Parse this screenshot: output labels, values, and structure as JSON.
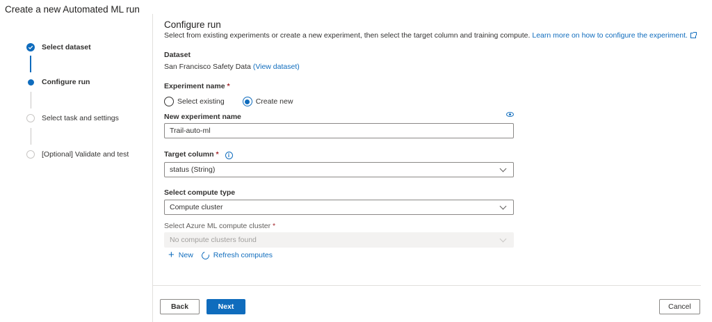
{
  "page": {
    "title": "Create a new Automated ML run"
  },
  "steps": [
    {
      "label": "Select dataset",
      "state": "done"
    },
    {
      "label": "Configure run",
      "state": "current"
    },
    {
      "label": "Select task and settings",
      "state": "pending"
    },
    {
      "label": "[Optional] Validate and test",
      "state": "pending"
    }
  ],
  "configure": {
    "title": "Configure run",
    "description": "Select from existing experiments or create a new experiment, then select the target column and training compute.",
    "learn_more": "Learn more on how to configure the experiment."
  },
  "dataset": {
    "label": "Dataset",
    "name": "San Francisco Safety Data",
    "view_link": "(View dataset)"
  },
  "experiment": {
    "label": "Experiment name",
    "required_mark": "*",
    "option_existing": "Select existing",
    "option_new": "Create new",
    "selected": "Create new",
    "new_name_label": "New experiment name",
    "new_name_value": "Trail-auto-ml"
  },
  "target_column": {
    "label": "Target column",
    "required_mark": "*",
    "info_glyph": "i",
    "value": "status (String)"
  },
  "compute_type": {
    "label": "Select compute type",
    "value": "Compute cluster"
  },
  "compute_cluster": {
    "label": "Select Azure ML compute cluster",
    "required_mark": "*",
    "value": "No compute clusters found",
    "new_label": "New",
    "refresh_label": "Refresh computes"
  },
  "footer": {
    "back_label": "Back",
    "next_label": "Next",
    "cancel_label": "Cancel"
  },
  "colors": {
    "accent": "#0f6cbd",
    "required": "#a4262c"
  },
  "icons": {
    "step_done": "check-circle-icon",
    "external_link": "external-link-icon",
    "info": "info-icon",
    "eye": "eye-icon",
    "chevron": "chevron-down-icon",
    "add": "plus-icon",
    "refresh": "refresh-icon"
  }
}
